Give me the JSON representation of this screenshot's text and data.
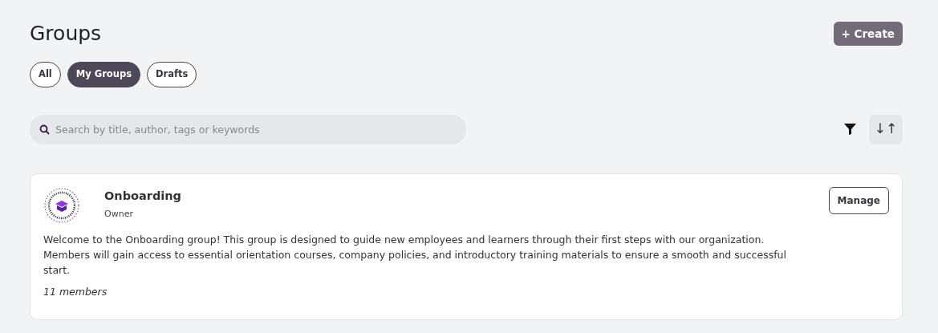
{
  "page": {
    "title": "Groups"
  },
  "create_button": {
    "label": "+ Create"
  },
  "filters": [
    {
      "label": "All",
      "selected": false
    },
    {
      "label": "My Groups",
      "selected": true
    },
    {
      "label": "Drafts",
      "selected": false
    }
  ],
  "search": {
    "placeholder": "Search by title, author, tags or keywords"
  },
  "sort_button": {
    "label": "↓↑"
  },
  "groups": [
    {
      "name": "Onboarding",
      "role": "Owner",
      "action": "Manage",
      "description": "Welcome to the Onboarding group! This group is designed to guide new employees and learners through their first steps with our organization. Members will gain access to essential orientation courses, company policies, and introductory training materials to ensure a smooth and successful start.",
      "members": "11 members"
    }
  ]
}
